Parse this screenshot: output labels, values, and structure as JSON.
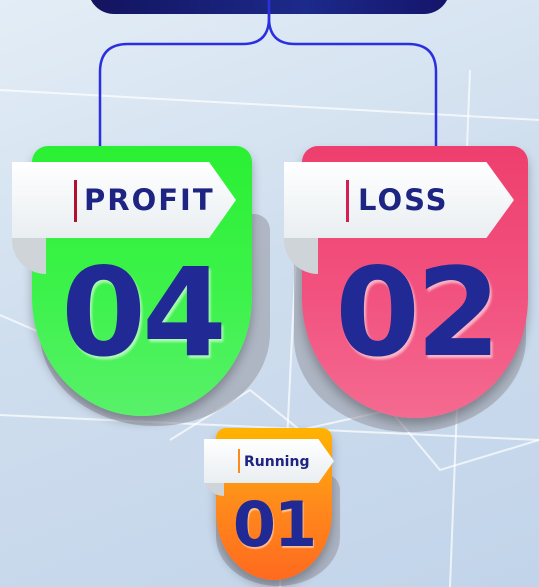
{
  "badges": {
    "profit": {
      "label": "PROFIT",
      "count": "04",
      "color": "#2ef43a",
      "accent": "#b2102f"
    },
    "loss": {
      "label": "LOSS",
      "count": "02",
      "color": "#f1507d",
      "accent": "#d41f52"
    },
    "running": {
      "label": "Running",
      "count": "01",
      "color": "#ff8a1c",
      "accent": "#ff8a1c"
    }
  }
}
